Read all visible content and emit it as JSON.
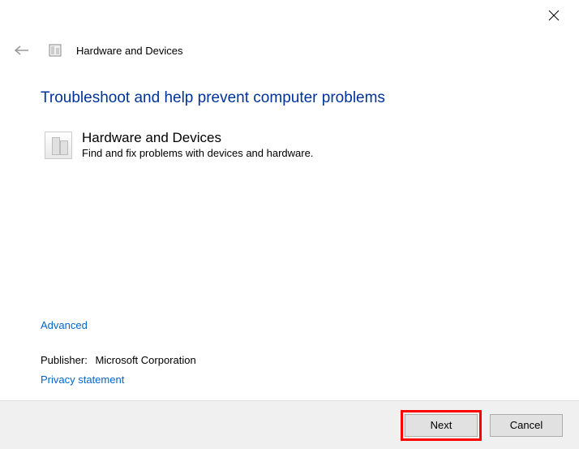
{
  "header": {
    "title": "Hardware and Devices"
  },
  "heading": "Troubleshoot and help prevent computer problems",
  "section": {
    "title": "Hardware and Devices",
    "description": "Find and fix problems with devices and hardware."
  },
  "links": {
    "advanced": "Advanced",
    "privacy": "Privacy statement"
  },
  "publisher": {
    "label": "Publisher:",
    "value": "Microsoft Corporation"
  },
  "buttons": {
    "next": "Next",
    "cancel": "Cancel"
  }
}
